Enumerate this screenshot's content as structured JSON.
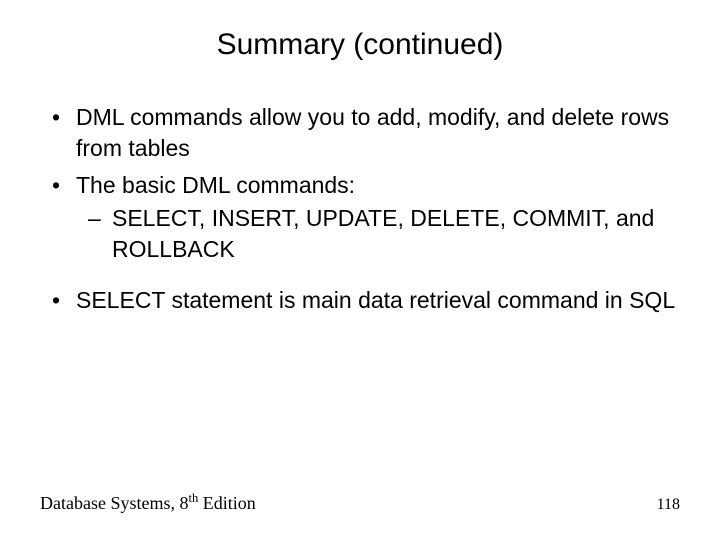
{
  "title": "Summary (continued)",
  "bullets": {
    "b1": "DML commands allow you to add, modify, and delete rows from tables",
    "b2": "The basic DML commands:",
    "b2_sub1": "SELECT, INSERT, UPDATE, DELETE, COMMIT, and ROLLBACK",
    "b3": "SELECT statement is main data retrieval command in SQL"
  },
  "footer": {
    "book_prefix": "Database Systems, 8",
    "book_ordinal": "th",
    "book_suffix": " Edition",
    "page_number": "118"
  }
}
